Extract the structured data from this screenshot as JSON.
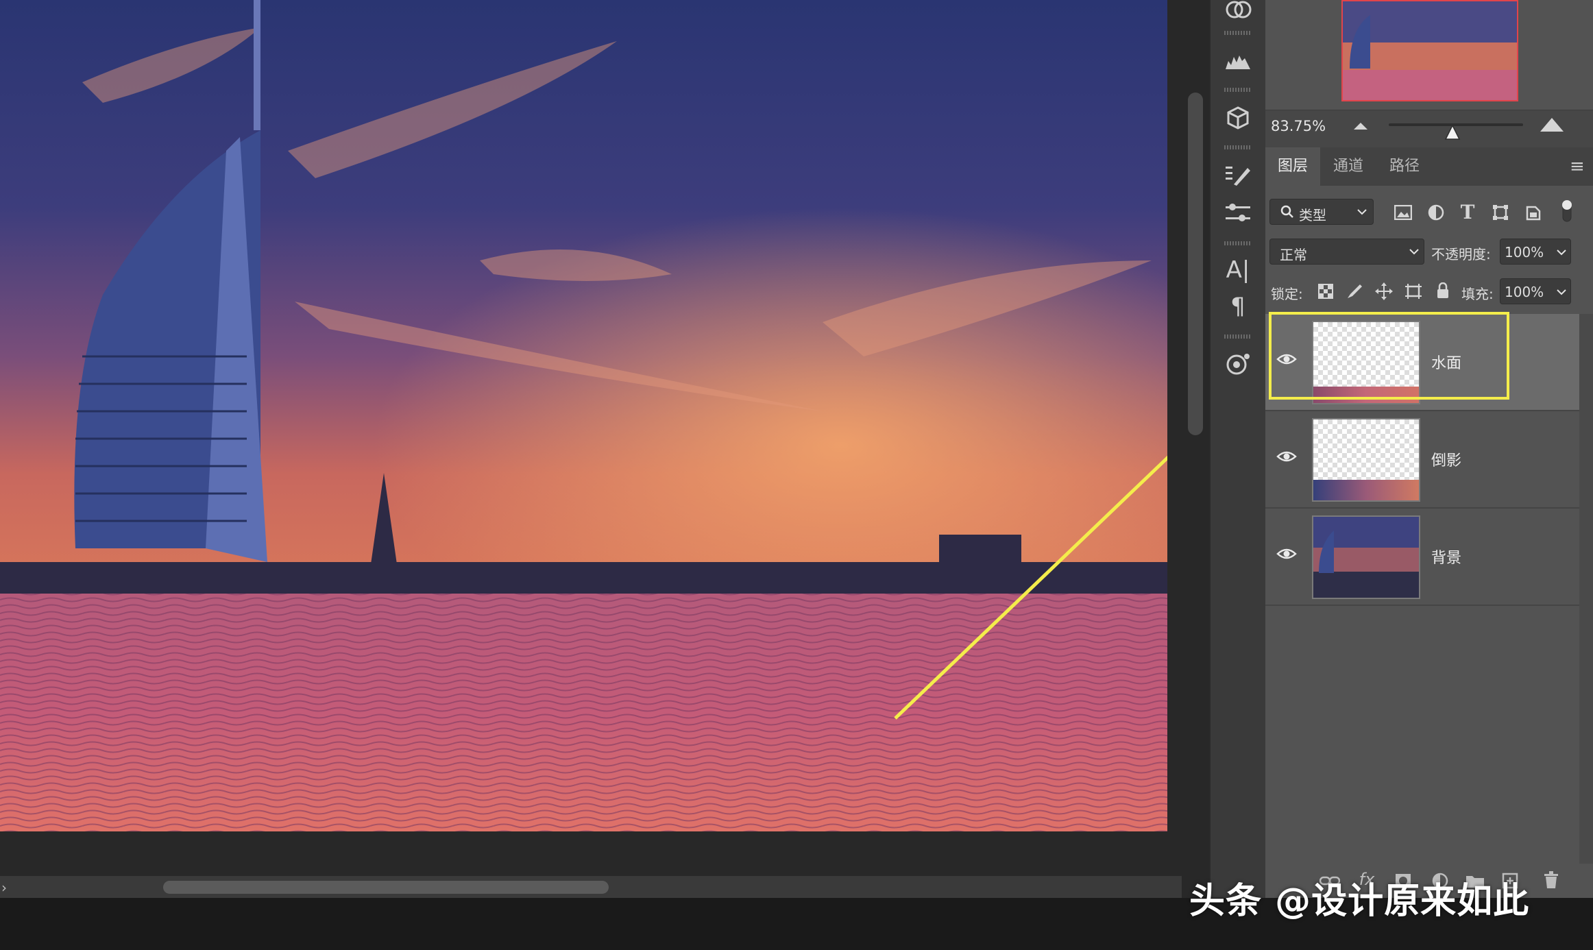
{
  "navigator": {
    "zoom": "83.75%"
  },
  "tabs": [
    {
      "label": "图层",
      "active": true
    },
    {
      "label": "通道",
      "active": false
    },
    {
      "label": "路径",
      "active": false
    }
  ],
  "filter": {
    "kind_label": "类型"
  },
  "blend": {
    "mode": "正常",
    "opacity_label": "不透明度:",
    "opacity_value": "100%"
  },
  "lock": {
    "label": "锁定:",
    "fill_label": "填充:",
    "fill_value": "100%"
  },
  "layers": [
    {
      "name": "水面",
      "visible": true,
      "selected": true
    },
    {
      "name": "倒影",
      "visible": true,
      "selected": false
    },
    {
      "name": "背景",
      "visible": true,
      "selected": false
    }
  ],
  "footer_icons": [
    "link-icon",
    "fx-icon",
    "mask-icon",
    "adjustment-icon",
    "folder-icon",
    "new-layer-icon",
    "trash-icon"
  ],
  "watermark": "头条 @设计原来如此",
  "colors": {
    "highlight": "#f4ed4b",
    "panel": "#535353",
    "selected_row": "#6b6b6b",
    "navigator_frame": "#e2444b"
  }
}
